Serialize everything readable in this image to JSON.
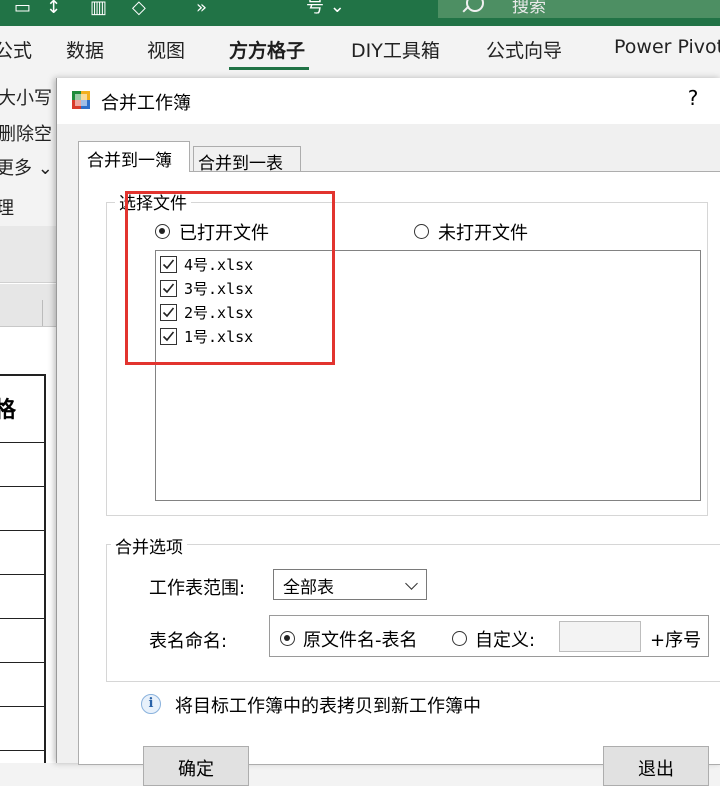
{
  "titlebar": {
    "qat_tail": "号 ⌄",
    "search_placeholder": "搜索"
  },
  "ribbon": {
    "tabs": [
      "公式",
      "数据",
      "视图",
      "方方格子",
      "DIY工具箱",
      "公式向导",
      "Power Pivot"
    ],
    "active_tab": "方方格子",
    "left_items": [
      "大小写",
      "删除空",
      "更多 ⌄",
      "理"
    ]
  },
  "sheet": {
    "visible_cell": "格"
  },
  "dialog": {
    "title": "合并工作簿",
    "help_label": "?",
    "tabs": [
      "合并到一簿",
      "合并到一表"
    ],
    "select_files": {
      "legend": "选择文件",
      "radio_opened": "已打开文件",
      "radio_unopened": "未打开文件",
      "selected": "已打开文件",
      "files": [
        "4号.xlsx",
        "3号.xlsx",
        "2号.xlsx",
        "1号.xlsx"
      ]
    },
    "merge_options": {
      "legend": "合并选项",
      "range_label": "工作表范围:",
      "range_value": "全部表",
      "naming_label": "表名命名:",
      "naming_option1": "原文件名-表名",
      "naming_option2": "自定义:",
      "naming_selected": "原文件名-表名",
      "custom_value": "",
      "suffix": "+序号"
    },
    "info_text": "将目标工作簿中的表拷贝到新工作簿中",
    "ok_label": "确定",
    "exit_label": "退出"
  },
  "colors": {
    "excel_green": "#217346",
    "highlight_red": "#e2342f"
  }
}
